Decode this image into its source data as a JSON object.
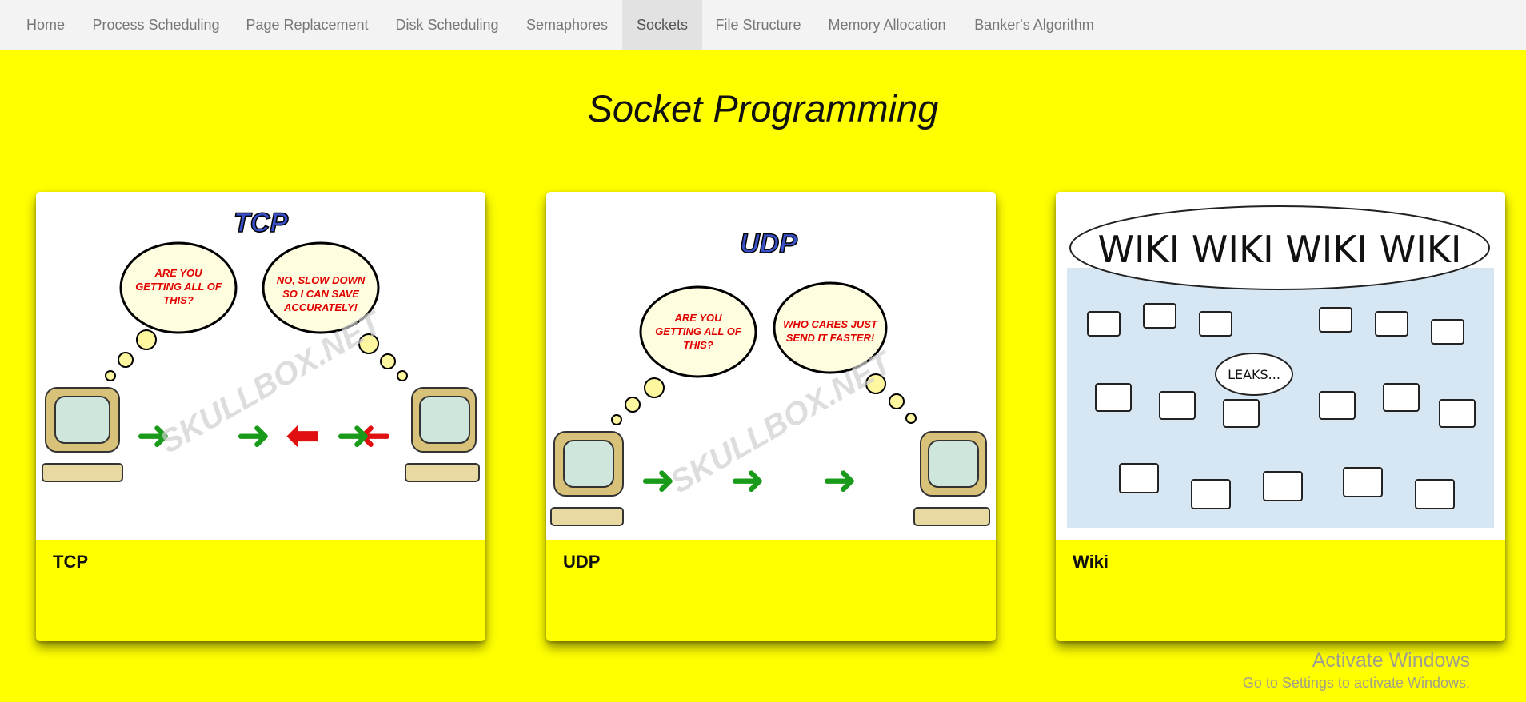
{
  "nav": {
    "items": [
      {
        "label": "Home"
      },
      {
        "label": "Process Scheduling"
      },
      {
        "label": "Page Replacement"
      },
      {
        "label": "Disk Scheduling"
      },
      {
        "label": "Semaphores"
      },
      {
        "label": "Sockets",
        "active": true
      },
      {
        "label": "File Structure"
      },
      {
        "label": "Memory Allocation"
      },
      {
        "label": "Banker's Algorithm"
      }
    ]
  },
  "page": {
    "title": "Socket Programming"
  },
  "cards": [
    {
      "label": "TCP",
      "image": {
        "heading": "TCP",
        "left_bubble": [
          "ARE YOU",
          "GETTING ALL OF",
          "THIS?"
        ],
        "right_bubble": [
          "NO, SLOW DOWN",
          "SO I CAN SAVE",
          "ACCURATELY!"
        ],
        "watermark": "SKULLBOX.NET"
      }
    },
    {
      "label": "UDP",
      "image": {
        "heading": "UDP",
        "left_bubble": [
          "ARE YOU",
          "GETTING ALL OF",
          "THIS?"
        ],
        "right_bubble": [
          "WHO CARES JUST",
          "SEND IT FASTER!"
        ],
        "watermark": "SKULLBOX.NET"
      }
    },
    {
      "label": "Wiki",
      "image": {
        "heading": "WIKI WIKI WIKI WIKI",
        "speech": "LEAKS..."
      }
    }
  ],
  "colors": {
    "background": "#ffff00",
    "nav_bg": "#f3f3f3",
    "nav_active": "#e2e2e2",
    "arrow_green": "#1a9a1a",
    "arrow_red": "#e01010",
    "bubble_text": "#e00000",
    "heading_blue": "#3a50c8"
  },
  "os_watermark": {
    "line1": "Activate Windows",
    "line2": "Go to Settings to activate Windows."
  }
}
